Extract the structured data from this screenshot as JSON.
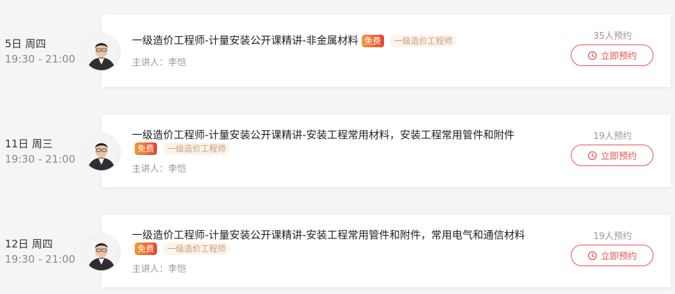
{
  "sessions": [
    {
      "day": "5日 周四",
      "time": "19:30 - 21:00",
      "title": "一级造价工程师-计量安装公开课精讲-非金属材料",
      "free_tag": "免费",
      "category_tag": "一级造价工程师",
      "teacher": "主讲人：李恺",
      "reservations": "35人预约",
      "button_label": "立即预约"
    },
    {
      "day": "11日 周三",
      "time": "19:30 - 21:00",
      "title": "一级造价工程师-计量安装公开课精讲-安装工程常用材料，安装工程常用管件和附件",
      "free_tag": "免费",
      "category_tag": "一级造价工程师",
      "teacher": "主讲人：李恺",
      "reservations": "19人预约",
      "button_label": "立即预约"
    },
    {
      "day": "12日 周四",
      "time": "19:30 - 21:00",
      "title": "一级造价工程师-计量安装公开课精讲-安装工程常用管件和附件，常用电气和通信材料",
      "free_tag": "免费",
      "category_tag": "一级造价工程师",
      "teacher": "主讲人：李恺",
      "reservations": "19人预约",
      "button_label": "立即预约"
    }
  ],
  "colors": {
    "accent": "#e8504f",
    "free_tag_gradient": [
      "#f39a3a",
      "#e8432b"
    ],
    "category_tag_bg": "#fcf3ea",
    "category_tag_text": "#c89f76"
  }
}
